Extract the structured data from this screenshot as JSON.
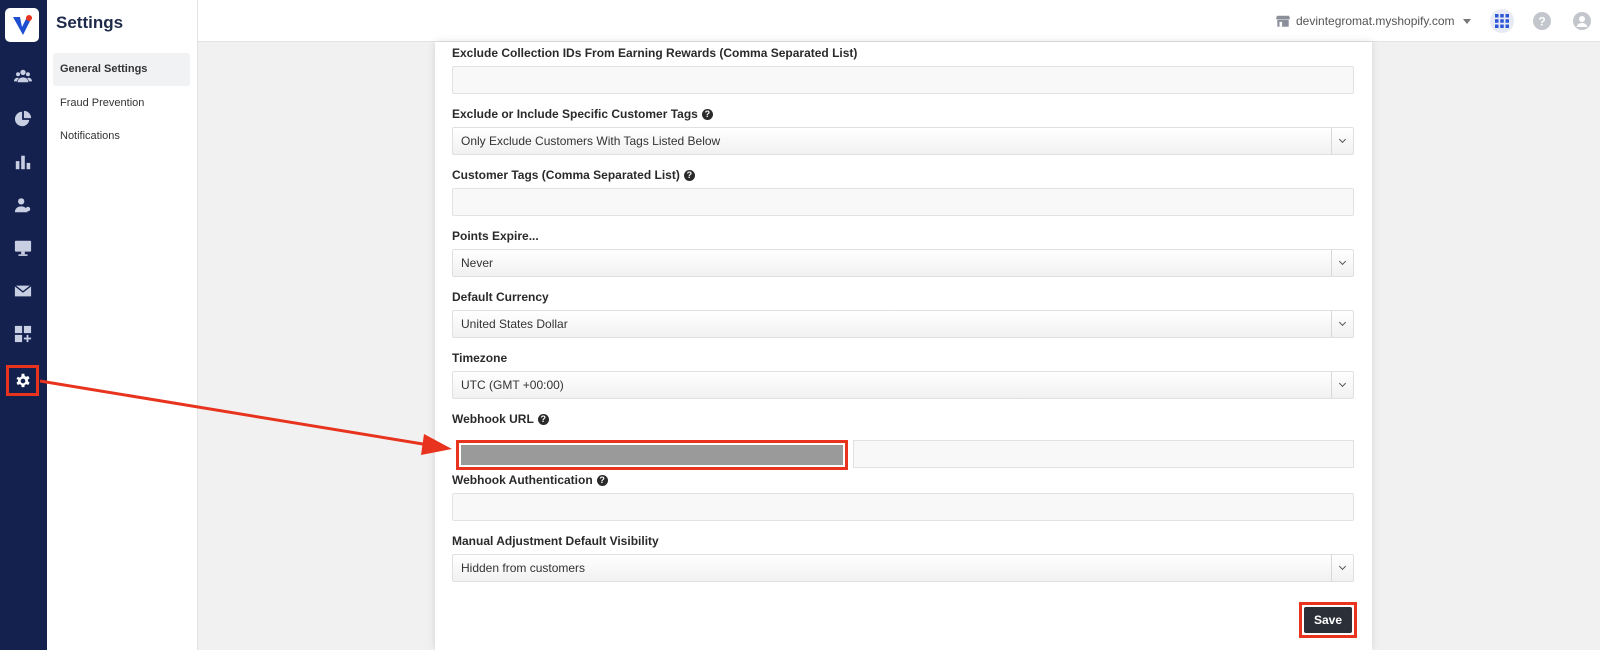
{
  "app": {
    "logo_icon": "v-logo-icon",
    "page_title": "Settings"
  },
  "rail": {
    "items": [
      {
        "icon": "users-icon"
      },
      {
        "icon": "pie-chart-icon"
      },
      {
        "icon": "bar-chart-icon"
      },
      {
        "icon": "customer-icon"
      },
      {
        "icon": "monitor-icon"
      },
      {
        "icon": "mail-icon"
      },
      {
        "icon": "apps-add-icon"
      },
      {
        "icon": "gear-icon",
        "active": true
      }
    ]
  },
  "subnav": {
    "items": [
      {
        "label": "General Settings",
        "active": true
      },
      {
        "label": "Fraud Prevention"
      },
      {
        "label": "Notifications"
      }
    ]
  },
  "topbar": {
    "store_name": "devintegromat.myshopify.com",
    "store_icon": "store-icon",
    "apps_icon": "grid-icon",
    "help_icon": "help-icon",
    "user_icon": "user-icon"
  },
  "form": {
    "exclude_collections_label": "Exclude Collection IDs From Earning Rewards (Comma Separated List)",
    "customer_tags_mode_label": "Exclude or Include Specific Customer Tags",
    "customer_tags_mode_value": "Only Exclude Customers With Tags Listed Below",
    "customer_tags_label": "Customer Tags (Comma Separated List)",
    "points_expire_label": "Points Expire...",
    "points_expire_value": "Never",
    "currency_label": "Default Currency",
    "currency_value": "United States Dollar",
    "timezone_label": "Timezone",
    "timezone_value": "UTC (GMT +00:00)",
    "webhook_url_label": "Webhook URL",
    "webhook_auth_label": "Webhook Authentication",
    "visibility_label": "Manual Adjustment Default Visibility",
    "visibility_value": "Hidden from customers",
    "save_label": "Save"
  },
  "colors": {
    "rail_bg": "#14214f",
    "highlight": "#e8341f",
    "save_bg": "#2b2f38"
  }
}
